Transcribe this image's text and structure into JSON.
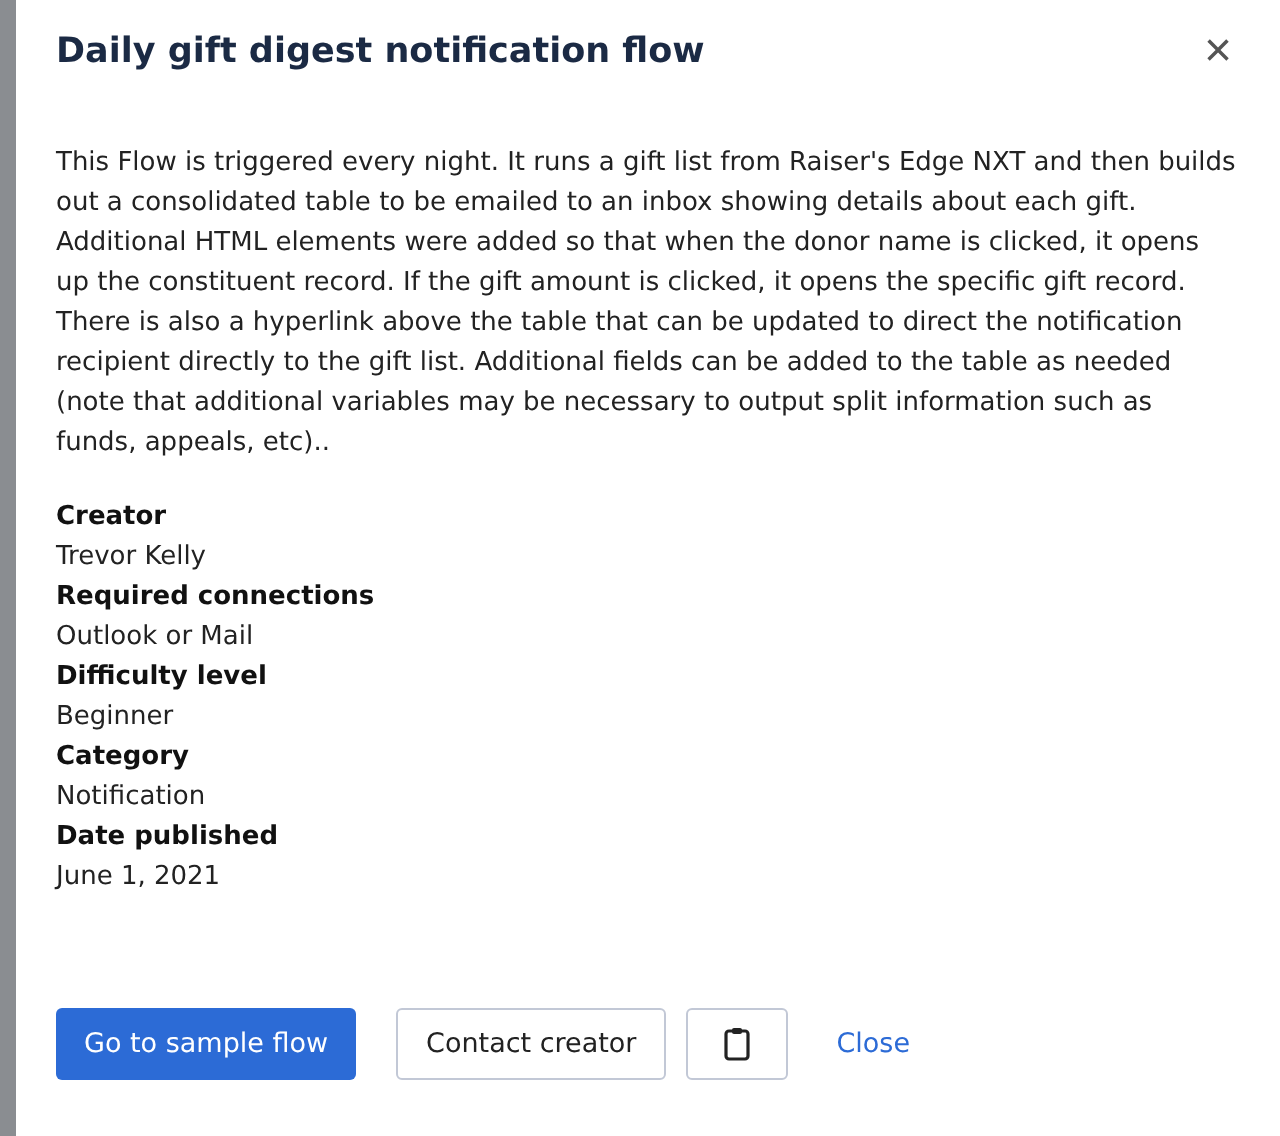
{
  "dialog": {
    "title": "Daily gift digest notification flow",
    "close_icon": "×",
    "description": "This Flow is triggered every night. It runs a gift list from Raiser's Edge NXT and then builds out a consolidated table to be emailed to an inbox showing details about each gift. Additional HTML elements were added so that when the donor name is clicked, it opens up the constituent record. If the gift amount is clicked, it opens the specific gift record. There is also a hyperlink above the table that can be updated to direct the notification recipient directly to the gift list. Additional fields can be added to the table as needed (note that additional variables may be necessary to output split information such as funds, appeals, etc)..",
    "details": [
      {
        "label": "Creator",
        "value": "Trevor Kelly"
      },
      {
        "label": "Required connections",
        "value": "Outlook or Mail"
      },
      {
        "label": "Difficulty level",
        "value": "Beginner"
      },
      {
        "label": "Category",
        "value": "Notification"
      },
      {
        "label": "Date published",
        "value": "June 1, 2021"
      }
    ],
    "actions": [
      {
        "kind": "primary",
        "label": "Go to sample flow"
      },
      {
        "kind": "secondary",
        "label": "Contact creator"
      },
      {
        "kind": "icon"
      },
      {
        "kind": "link",
        "label": "Close"
      }
    ]
  }
}
